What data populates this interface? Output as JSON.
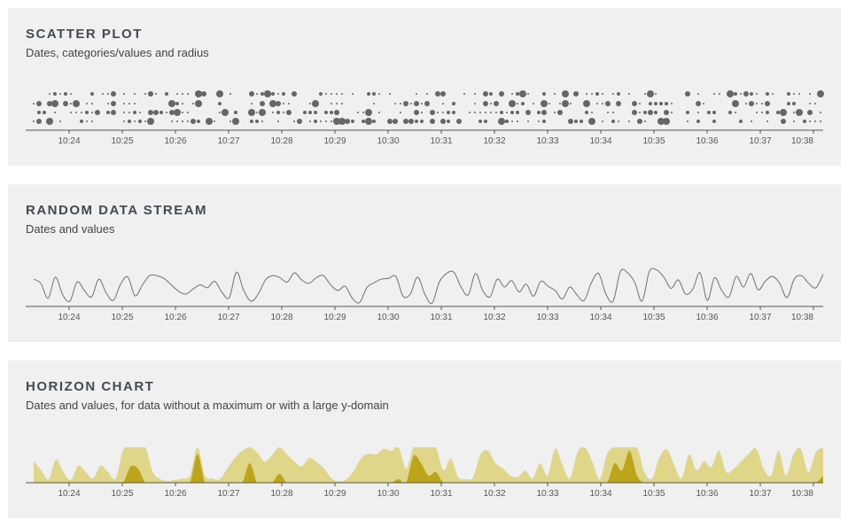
{
  "colors": {
    "panel_bg": "#f0f0f0",
    "title": "#444a52",
    "dot": "#666666",
    "line": "#707070",
    "axis": "#555555",
    "horizon_band1": "#e0d689",
    "horizon_band2": "#bda51b"
  },
  "panels": [
    {
      "title": "SCATTER PLOT",
      "subtitle": "Dates, categories/values and radius"
    },
    {
      "title": "RANDOM DATA STREAM",
      "subtitle": "Dates and values"
    },
    {
      "title": "HORIZON CHART",
      "subtitle": "Dates and values, for data without a maximum or with a large y-domain"
    }
  ],
  "chart_data": [
    {
      "type": "scatter",
      "title": "SCATTER PLOT",
      "subtitle": "Dates, categories/values and radius",
      "x_ticks": [
        "10:24",
        "10:25",
        "10:26",
        "10:27",
        "10:28",
        "10:29",
        "10:30",
        "10:31",
        "10:32",
        "10:33",
        "10:34",
        "10:35",
        "10:36",
        "10:37",
        "10:38"
      ],
      "categories": [
        1,
        2,
        3,
        4
      ],
      "x_domain": [
        "10:23:13",
        "10:38:05"
      ],
      "grid": false,
      "note_sizes": "radius varies 1-5"
    },
    {
      "type": "line",
      "title": "RANDOM DATA STREAM",
      "subtitle": "Dates and values",
      "x_ticks": [
        "10:24",
        "10:25",
        "10:26",
        "10:27",
        "10:28",
        "10:29",
        "10:30",
        "10:31",
        "10:32",
        "10:33",
        "10:34",
        "10:35",
        "10:36",
        "10:37",
        "10:38"
      ],
      "x_domain": [
        "10:23:13",
        "10:38:05"
      ],
      "grid": false,
      "series": [
        {
          "values": [
            0.72,
            0.6,
            0.18,
            0.78,
            0.28,
            0.1,
            0.64,
            0.4,
            0.22,
            0.72,
            0.34,
            0.12,
            0.58,
            0.78,
            0.25,
            0.55,
            0.82,
            0.82,
            0.74,
            0.56,
            0.38,
            0.3,
            0.44,
            0.56,
            0.48,
            0.66,
            0.35,
            0.2,
            0.92,
            0.4,
            0.1,
            0.3,
            0.7,
            0.82,
            0.76,
            0.64,
            0.9,
            0.7,
            0.6,
            0.76,
            0.82,
            0.56,
            0.4,
            0.52,
            0.18,
            0.06,
            0.48,
            0.62,
            0.72,
            0.74,
            0.8,
            0.24,
            0.3,
            0.78,
            0.3,
            0.04,
            0.64,
            0.88,
            0.92,
            0.5,
            0.28,
            0.88,
            0.4,
            0.22,
            0.72,
            0.5,
            0.68,
            0.36,
            0.58,
            0.24,
            0.66,
            0.52,
            0.4,
            0.16,
            0.5,
            0.28,
            0.12,
            0.62,
            0.88,
            0.3,
            0.1,
            0.94,
            0.9,
            0.62,
            0.1,
            0.94,
            0.98,
            0.78,
            0.46,
            0.7,
            0.3,
            0.44,
            0.9,
            0.12,
            0.76,
            0.4,
            0.22,
            0.8,
            0.5,
            0.88,
            0.42,
            0.66,
            0.8,
            0.6,
            0.2,
            0.72,
            0.82,
            0.6,
            0.48,
            0.86
          ]
        }
      ]
    },
    {
      "type": "area",
      "title": "HORIZON CHART",
      "subtitle": "Dates and values, for data without a maximum or with a large y-domain",
      "x_ticks": [
        "10:24",
        "10:25",
        "10:26",
        "10:27",
        "10:28",
        "10:29",
        "10:30",
        "10:31",
        "10:32",
        "10:33",
        "10:34",
        "10:35",
        "10:36",
        "10:37",
        "10:38"
      ],
      "x_domain": [
        "10:23:13",
        "10:38:05"
      ],
      "bands": 2,
      "grid": false,
      "series": [
        {
          "values": [
            0.62,
            0.35,
            0.1,
            0.65,
            0.3,
            0.08,
            0.48,
            0.3,
            0.12,
            0.48,
            0.3,
            0.12,
            0.92,
            1.45,
            1.4,
            1.0,
            0.3,
            0.1,
            0.05,
            0.08,
            0.12,
            0.2,
            1.8,
            0.2,
            0.12,
            0.1,
            0.4,
            0.7,
            0.9,
            1.55,
            0.86,
            0.6,
            0.78,
            1.25,
            0.8,
            0.6,
            0.46,
            0.7,
            0.58,
            0.4,
            0.12,
            0.04,
            0.1,
            0.34,
            0.7,
            0.82,
            0.8,
            0.96,
            0.9,
            1.1,
            0.4,
            1.75,
            1.55,
            1.2,
            1.3,
            0.35,
            0.68,
            0.16,
            0.1,
            0.15,
            0.8,
            0.9,
            0.55,
            0.4,
            0.2,
            0.16,
            0.34,
            0.12,
            0.55,
            0.2,
            0.96,
            0.5,
            0.12,
            0.85,
            1.0,
            0.6,
            0.1,
            0.82,
            1.55,
            1.35,
            1.9,
            1.2,
            0.3,
            0.12,
            0.7,
            0.94,
            0.5,
            0.12,
            0.8,
            0.35,
            0.6,
            0.45,
            0.9,
            0.3,
            0.4,
            0.6,
            0.82,
            0.96,
            0.4,
            0.2,
            0.9,
            0.2,
            0.8,
            0.95,
            0.3,
            0.85,
            1.2
          ]
        }
      ]
    }
  ]
}
